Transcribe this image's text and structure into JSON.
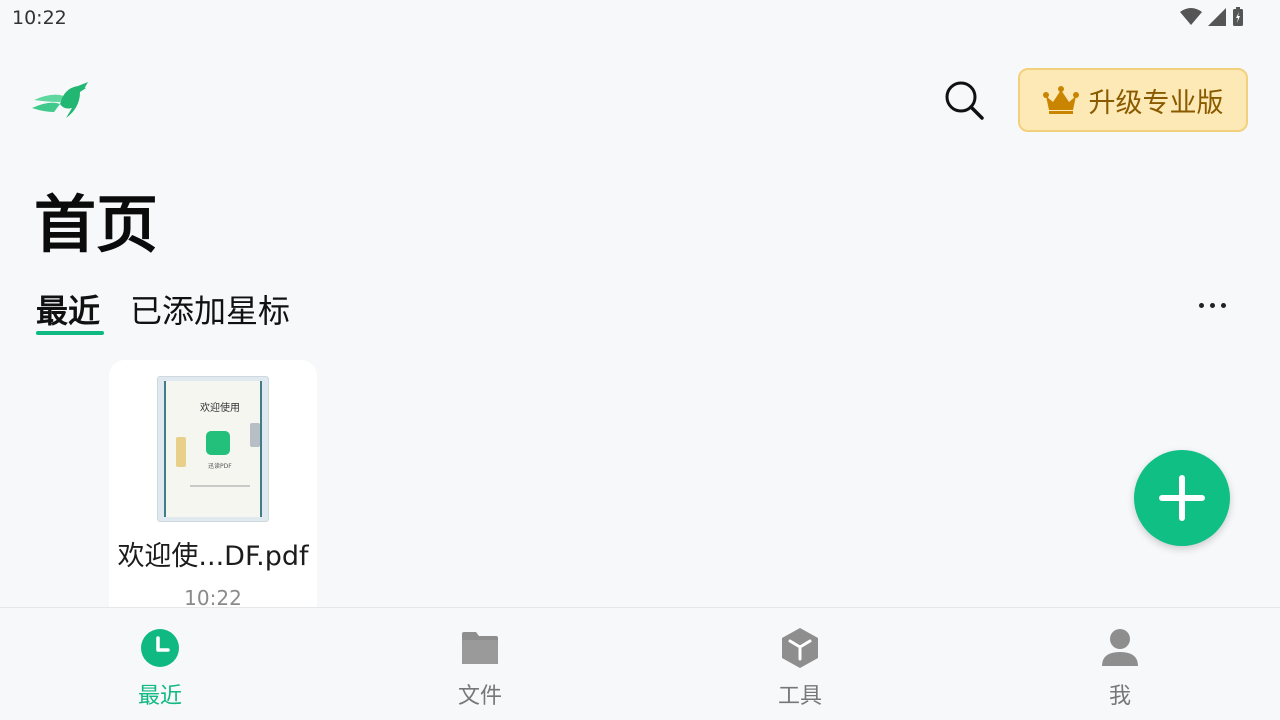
{
  "status_bar": {
    "time": "10:22"
  },
  "header": {
    "upgrade_label": "升级专业版"
  },
  "page": {
    "title": "首页"
  },
  "tabs": [
    {
      "label": "最近",
      "active": true
    },
    {
      "label": "已添加星标",
      "active": false
    }
  ],
  "files": [
    {
      "name": "欢迎使...DF.pdf",
      "time": "10:22",
      "thumb_title": "欢迎使用",
      "thumb_sub": "迅读PDF"
    }
  ],
  "bottom_nav": [
    {
      "label": "最近",
      "icon": "clock-icon",
      "active": true
    },
    {
      "label": "文件",
      "icon": "folder-icon",
      "active": false
    },
    {
      "label": "工具",
      "icon": "cube-icon",
      "active": false
    },
    {
      "label": "我",
      "icon": "person-icon",
      "active": false
    }
  ],
  "colors": {
    "accent": "#10b981",
    "upgrade_bg": "#fde9b6",
    "upgrade_text": "#8a5a00",
    "inactive_nav": "#777777"
  }
}
